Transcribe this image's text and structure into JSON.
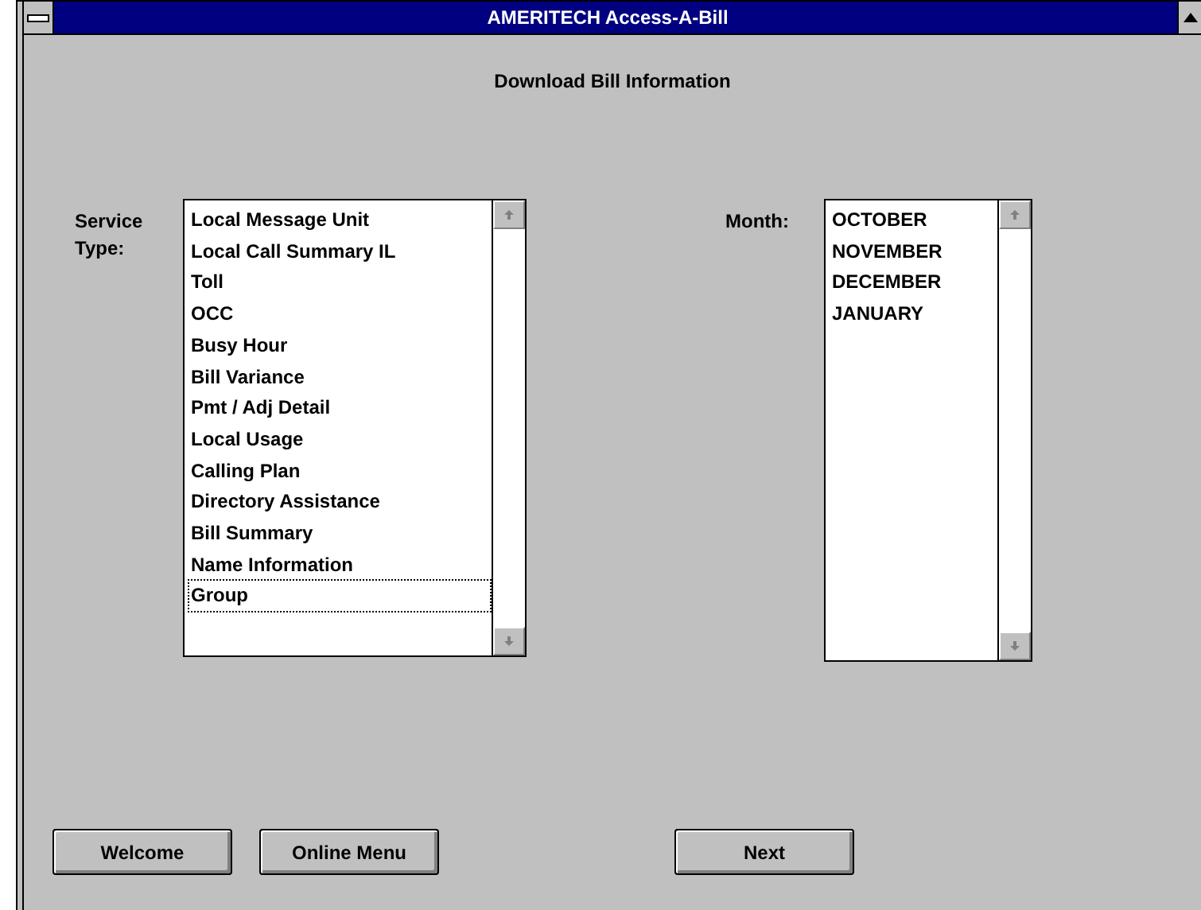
{
  "window": {
    "title": "AMERITECH Access-A-Bill",
    "heading": "Download Bill Information"
  },
  "service_type": {
    "label": "Service Type:",
    "items": [
      {
        "label": "Local Message Unit",
        "focused": false
      },
      {
        "label": "Local Call Summary IL",
        "focused": false
      },
      {
        "label": "Toll",
        "focused": false
      },
      {
        "label": "OCC",
        "focused": false
      },
      {
        "label": "Busy Hour",
        "focused": false
      },
      {
        "label": "Bill Variance",
        "focused": false
      },
      {
        "label": "Pmt / Adj Detail",
        "focused": false
      },
      {
        "label": "Local Usage",
        "focused": false
      },
      {
        "label": "Calling Plan",
        "focused": false
      },
      {
        "label": "Directory Assistance",
        "focused": false
      },
      {
        "label": "Bill Summary",
        "focused": false
      },
      {
        "label": "Name Information",
        "focused": false
      },
      {
        "label": "Group",
        "focused": true
      }
    ]
  },
  "month": {
    "label": "Month:",
    "items": [
      {
        "label": "OCTOBER",
        "focused": false
      },
      {
        "label": "NOVEMBER",
        "focused": false
      },
      {
        "label": "DECEMBER",
        "focused": false
      },
      {
        "label": "JANUARY",
        "focused": false
      }
    ]
  },
  "buttons": [
    "Welcome",
    "Online Menu",
    "Next"
  ]
}
